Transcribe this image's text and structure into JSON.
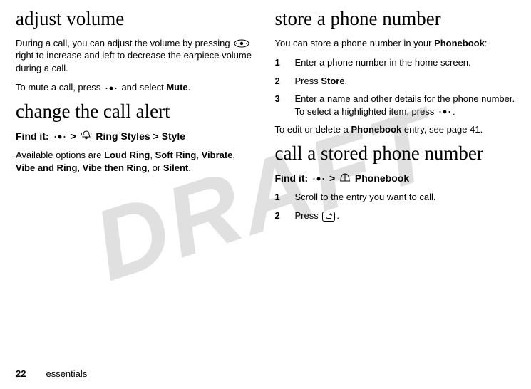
{
  "watermark": "DRAFT",
  "left": {
    "h1a": "adjust volume",
    "p1a": "During a call, you can adjust the volume by pressing ",
    "p1b": " right to increase and left to decrease the earpiece volume during a call.",
    "p2a": "To mute a call, press ",
    "p2b": " and select ",
    "mute": "Mute",
    "p2c": ".",
    "h1b": "change the call alert",
    "findit_label": "Find it:",
    "findit_path1": " > ",
    "findit_path2": " Ring Styles > Style",
    "p3a": "Available options are ",
    "opt1": "Loud Ring",
    "c1": ",  ",
    "opt2": "Soft Ring",
    "c2": ",  ",
    "opt3": "Vibrate",
    "c3": ",  ",
    "opt4": "Vibe and Ring",
    "c4": ", ",
    "opt5": "Vibe then Ring",
    "c5": ",  or ",
    "opt6": "Silent",
    "p3end": "."
  },
  "right": {
    "h1a": "store a phone number",
    "p1a": "You can store a phone number in your ",
    "pb": "Phonebook",
    "p1b": ":",
    "steps_store": [
      {
        "n": "1",
        "t": "Enter a phone number in the home screen."
      },
      {
        "n": "2",
        "t_a": "Press ",
        "storekey": "Store",
        "t_b": "."
      },
      {
        "n": "3",
        "t_a": "Enter a name and other details for the phone number. To select a highlighted item, press ",
        "t_b": "."
      }
    ],
    "p2a": "To edit or delete a ",
    "p2b": " entry, see page 41.",
    "h1b": "call a stored phone number",
    "findit_label": "Find it:",
    "gt": " > ",
    "pb2": " Phonebook",
    "steps_call": [
      {
        "n": "1",
        "t": "Scroll to the entry you want to call."
      },
      {
        "n": "2",
        "t_a": "Press ",
        "t_b": "."
      }
    ]
  },
  "footer": {
    "page": "22",
    "section": "essentials"
  }
}
